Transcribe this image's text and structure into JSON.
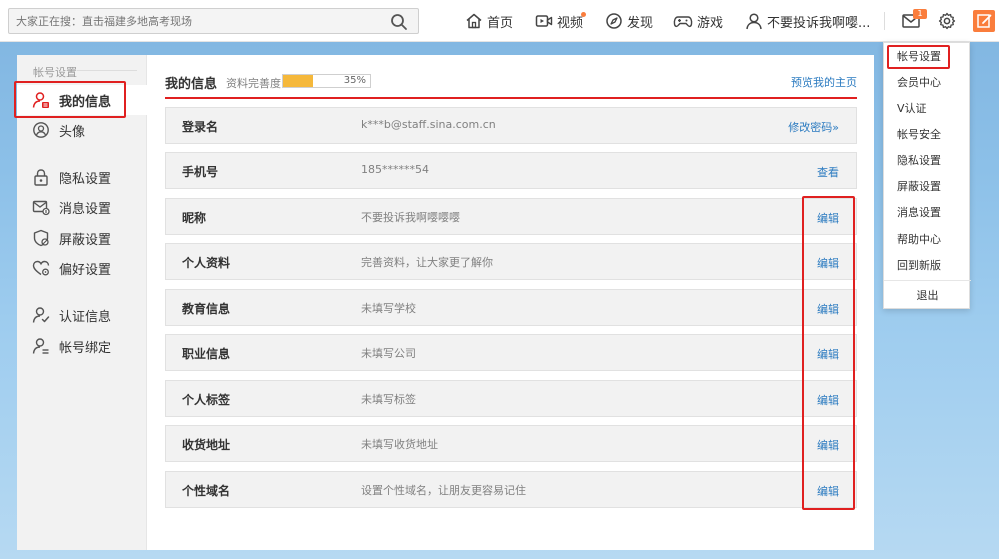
{
  "search": {
    "placeholder": "大家正在搜：直击福建多地高考现场"
  },
  "nav": {
    "home": "首页",
    "video": "视频",
    "discover": "发现",
    "game": "游戏",
    "user": "不要投诉我啊嘤..."
  },
  "notifications": {
    "badge": "1"
  },
  "sidebar": {
    "group_title": "帐号设置",
    "items": [
      {
        "label": "我的信息"
      },
      {
        "label": "头像"
      },
      {
        "label": "隐私设置"
      },
      {
        "label": "消息设置"
      },
      {
        "label": "屏蔽设置"
      },
      {
        "label": "偏好设置"
      },
      {
        "label": "认证信息"
      },
      {
        "label": "帐号绑定"
      }
    ]
  },
  "main": {
    "title": "我的信息",
    "completeness_label": "资料完善度",
    "completeness_value": "35%",
    "completeness_fraction": 0.35,
    "preview_link": "预览我的主页",
    "rows": [
      {
        "label": "登录名",
        "value": "k***b@staff.sina.com.cn",
        "action": "修改密码»"
      },
      {
        "label": "手机号",
        "value": "185******54",
        "action": "查看"
      },
      {
        "label": "昵称",
        "value": "不要投诉我啊嘤嘤嘤",
        "action": "编辑"
      },
      {
        "label": "个人资料",
        "value": "完善资料，让大家更了解你",
        "action": "编辑"
      },
      {
        "label": "教育信息",
        "value": "未填写学校",
        "action": "编辑"
      },
      {
        "label": "职业信息",
        "value": "未填写公司",
        "action": "编辑"
      },
      {
        "label": "个人标签",
        "value": "未填写标签",
        "action": "编辑"
      },
      {
        "label": "收货地址",
        "value": "未填写收货地址",
        "action": "编辑"
      },
      {
        "label": "个性域名",
        "value": "设置个性域名，让朋友更容易记住",
        "action": "编辑"
      }
    ]
  },
  "dropdown": {
    "items": [
      "帐号设置",
      "会员中心",
      "V认证",
      "帐号安全",
      "隐私设置",
      "屏蔽设置",
      "消息设置",
      "帮助中心",
      "回到新版"
    ],
    "logout": "退出"
  },
  "colors": {
    "accent": "#fa7d3c",
    "link": "#2a7ac0",
    "highlight": "#e02020",
    "progress": "#f5b83b"
  },
  "icons": [
    "search-icon",
    "home-icon",
    "video-icon",
    "compass-icon",
    "game-icon",
    "user-icon",
    "mail-icon",
    "gear-icon",
    "edit-icon",
    "profile-icon",
    "avatar-icon",
    "lock-icon",
    "message-icon",
    "shield-icon",
    "heart-icon",
    "verify-icon",
    "bind-icon"
  ]
}
